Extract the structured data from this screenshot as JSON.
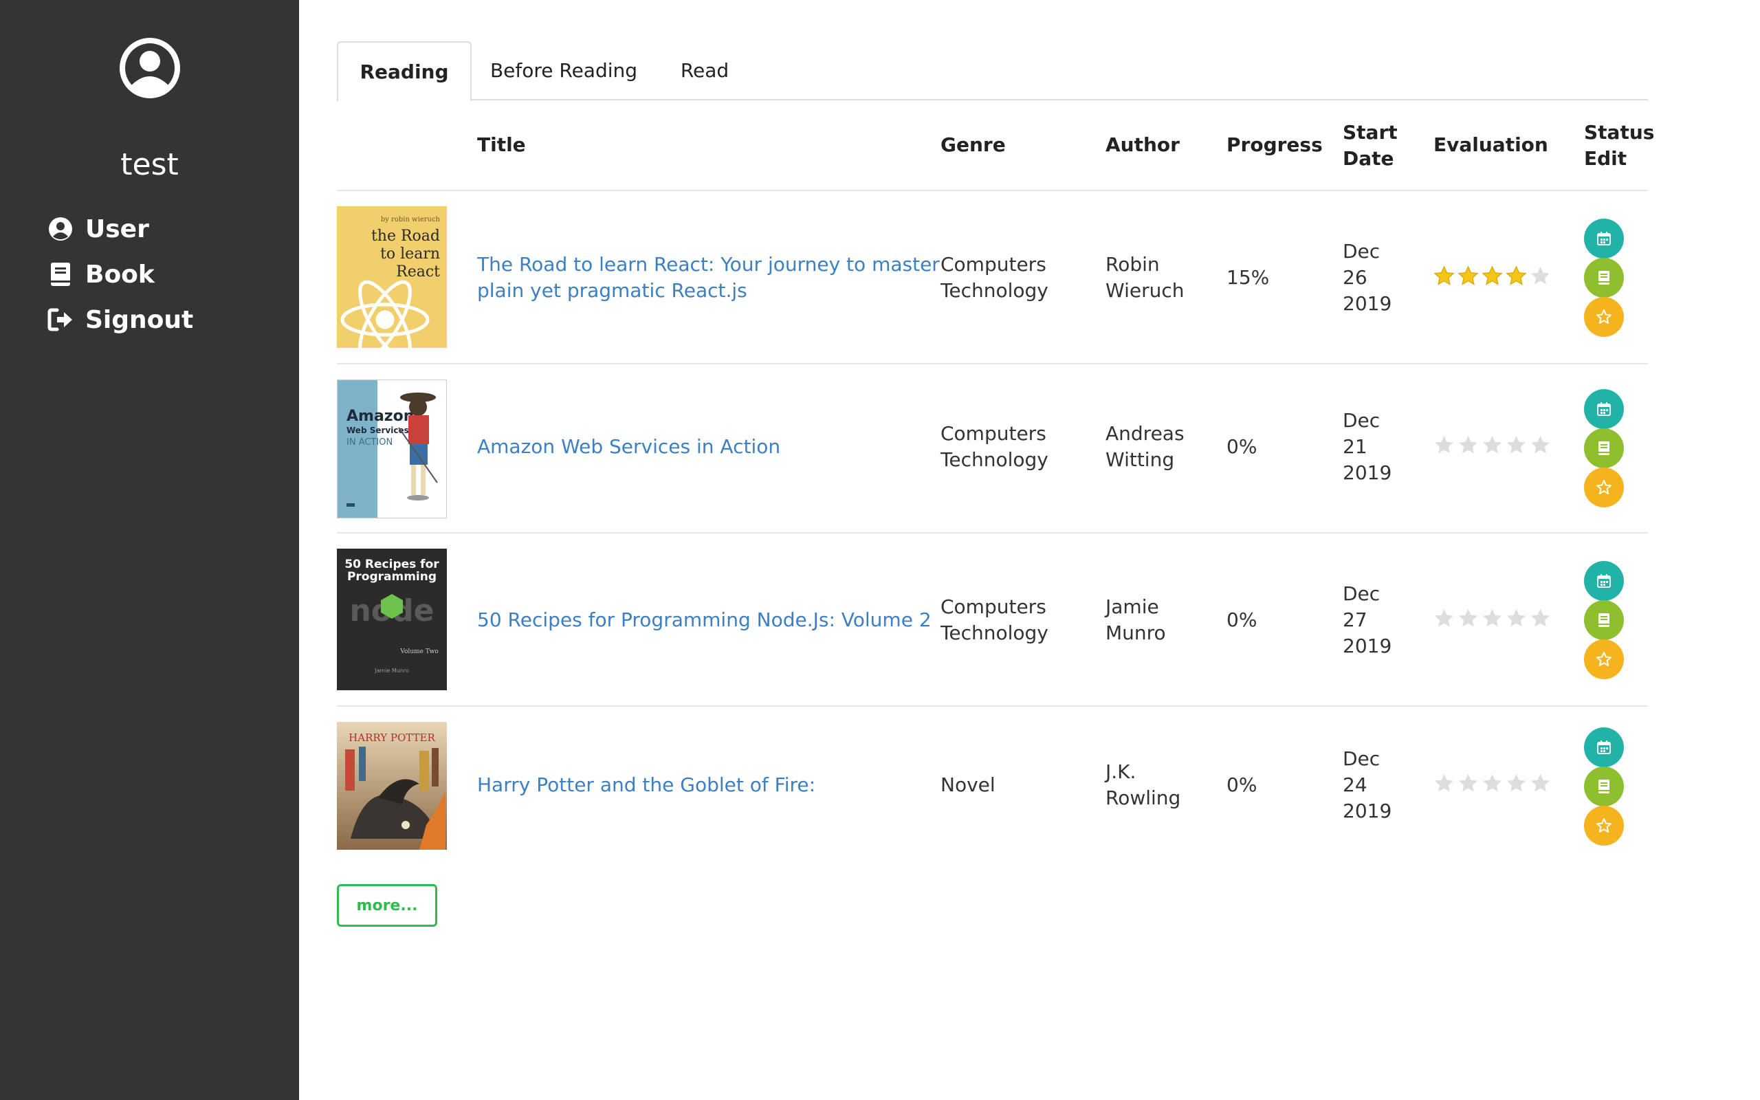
{
  "sidebar": {
    "username": "test",
    "nav": [
      {
        "label": "User",
        "icon": "user-circle-icon"
      },
      {
        "label": "Book",
        "icon": "book-icon"
      },
      {
        "label": "Signout",
        "icon": "sign-out-icon"
      }
    ]
  },
  "tabs": [
    "Reading",
    "Before Reading",
    "Read"
  ],
  "active_tab": "Reading",
  "table": {
    "headers": {
      "title": "Title",
      "genre": "Genre",
      "author": "Author",
      "progress": "Progress",
      "start_date_1": "Start",
      "start_date_2": "Date",
      "evaluation": "Evaluation",
      "status_edit_1": "Status",
      "status_edit_2": "Edit"
    },
    "rows": [
      {
        "title_1": "The Road to learn React: Your journey to master",
        "title_2": "plain yet pragmatic React.js",
        "genre_1": "Computers",
        "genre_2": "Technology",
        "author_1": "Robin",
        "author_2": "Wieruch",
        "progress": "15%",
        "date_1": "Dec",
        "date_2": "26",
        "date_3": "2019",
        "rating": 4,
        "cover": {
          "title_lines": [
            "the Road",
            "to learn",
            "React"
          ],
          "byline": "by robin wieruch"
        }
      },
      {
        "title_1": "Amazon Web Services in Action",
        "genre_1": "Computers",
        "genre_2": "Technology",
        "author_1": "Andreas",
        "author_2": "Witting",
        "progress": "0%",
        "date_1": "Dec",
        "date_2": "21",
        "date_3": "2019",
        "rating": 0,
        "cover": {
          "title_lines": [
            "Amazon",
            "Web Services",
            "IN ACTION"
          ]
        }
      },
      {
        "title_1": "50 Recipes for Programming Node.Js: Volume 2",
        "genre_1": "Computers",
        "genre_2": "Technology",
        "author_1": "Jamie",
        "author_2": "Munro",
        "progress": "0%",
        "date_1": "Dec",
        "date_2": "27",
        "date_3": "2019",
        "rating": 0,
        "cover": {
          "title_lines": [
            "50 Recipes for",
            "Programming"
          ],
          "word": "node",
          "subtitle": "Volume Two",
          "author": "Jamie Munro"
        }
      },
      {
        "title_1": "Harry Potter and the Goblet of Fire:",
        "genre_1": "Novel",
        "author_1": "J.K.",
        "author_2": "Rowling",
        "progress": "0%",
        "date_1": "Dec",
        "date_2": "24",
        "date_3": "2019",
        "rating": 0,
        "cover": {
          "title_lines": [
            "HARRY POTTER"
          ]
        }
      }
    ]
  },
  "more_label": "more...",
  "colors": {
    "sidebar_bg": "#343434",
    "link": "#3b7fc4",
    "star_on": "#f5c518",
    "star_off": "#dddddd",
    "btn_calendar": "#22b3a8",
    "btn_book": "#8dbf2f",
    "btn_star": "#f5b41d",
    "more_btn": "#2fbb4f"
  }
}
